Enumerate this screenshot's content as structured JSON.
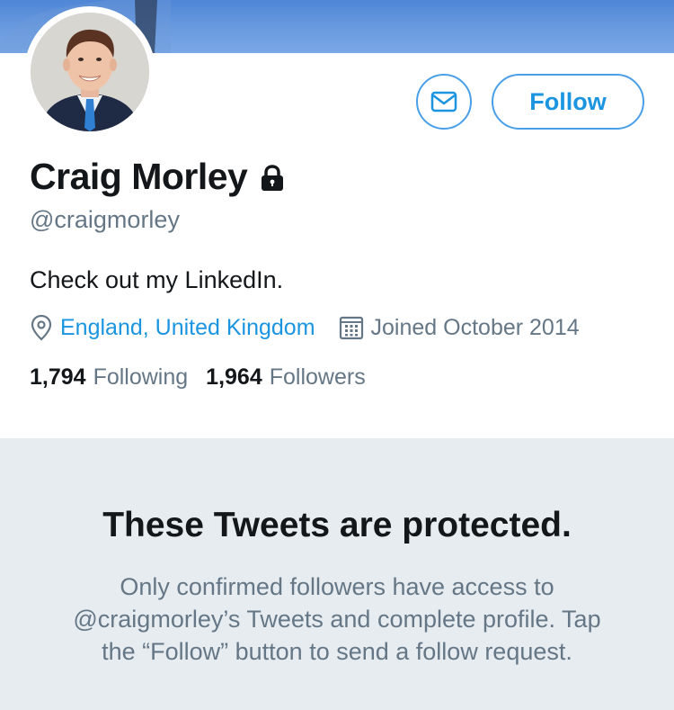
{
  "header": {
    "message_icon": "envelope-icon",
    "follow_label": "Follow"
  },
  "profile": {
    "name": "Craig Morley",
    "locked_icon": "lock-icon",
    "handle": "@craigmorley",
    "bio": "Check out my LinkedIn.",
    "location_icon": "location-pin-icon",
    "location": "England, United Kingdom",
    "joined_icon": "calendar-icon",
    "joined": "Joined October 2014",
    "following_count": "1,794",
    "following_label": "Following",
    "followers_count": "1,964",
    "followers_label": "Followers"
  },
  "protected": {
    "title": "These Tweets are protected.",
    "description": "Only confirmed followers have access to @craigmorley’s Tweets and complete profile. Tap the “Follow” button to send a follow request."
  },
  "colors": {
    "accent": "#1b95e0",
    "secondary_text": "#657786",
    "panel_background": "#e6ecf0"
  }
}
